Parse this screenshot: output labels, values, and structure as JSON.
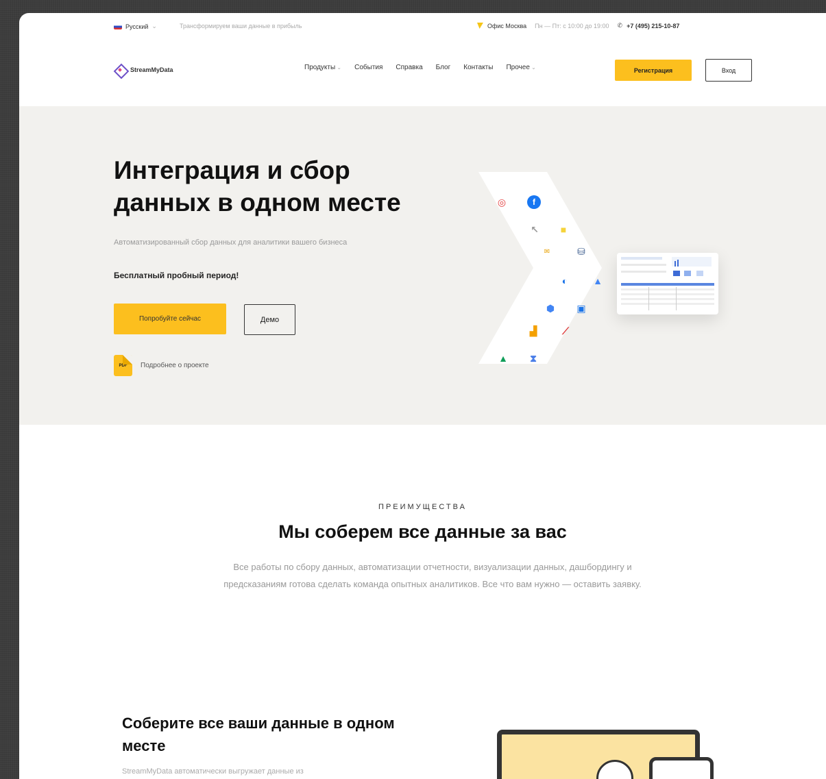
{
  "topbar": {
    "language": "Русский",
    "tagline": "Трансформируем ваши данные в прибыль",
    "office": "Офис Москва",
    "hours": "Пн — Пт: с 10:00 до 19:00",
    "phone": "+7 (495) 215-10-87"
  },
  "header": {
    "logo_text": "StreamMyData",
    "nav": {
      "products": "Продукты",
      "events": "События",
      "help": "Справка",
      "blog": "Блог",
      "contacts": "Контакты",
      "other": "Прочее"
    },
    "register_label": "Регистрация",
    "login_label": "Вход"
  },
  "hero": {
    "title": "Интеграция и сбор данных в одном месте",
    "subtitle": "Автоматизированный сбор данных для аналитики вашего бизнеса",
    "trial": "Бесплатный пробный период!",
    "try_label": "Попробуйте сейчас",
    "demo_label": "Демо",
    "pdf_badge": "PDF",
    "pdf_link": "Подробнее о проекте"
  },
  "advantages": {
    "eyebrow": "ПРЕИМУЩЕСТВА",
    "title": "Мы соберем все данные за вас",
    "text": "Все работы по сбору данных, автоматизации отчетности, визуализации данных, дашбордингу и предсказаниям готова сделать команда опытных аналитиков. Все что вам нужно — оставить заявку."
  },
  "collect": {
    "title": "Соберите все ваши данные в одном месте",
    "text": "StreamMyData автоматически выгружает данные из"
  },
  "colors": {
    "accent": "#fcbf1e",
    "hero_bg": "#f2f1ee"
  }
}
